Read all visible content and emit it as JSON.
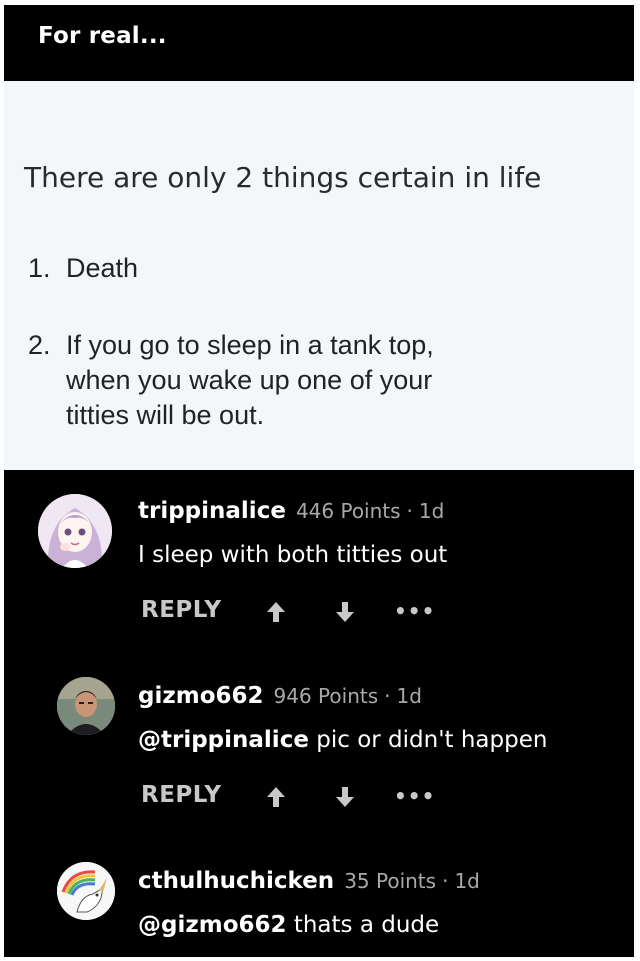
{
  "header": {
    "title": "For real..."
  },
  "post": {
    "heading": "There are only 2 things certain in life",
    "items": [
      {
        "num": "1.",
        "lines": [
          "Death"
        ]
      },
      {
        "num": "2.",
        "lines": [
          "If you go to sleep in a tank top,",
          "when you wake up one of your",
          "titties will be out."
        ]
      }
    ]
  },
  "comments": [
    {
      "username": "trippinalice",
      "points": "446 Points",
      "separator": "·",
      "age": "1d",
      "mention": "",
      "text": "I sleep with both titties out",
      "reply_label": "REPLY",
      "avatar": "avatar-anime-girl"
    },
    {
      "username": "gizmo662",
      "points": "946 Points",
      "separator": "·",
      "age": "1d",
      "mention": "@trippinalice",
      "text": " pic or didn't happen",
      "reply_label": "REPLY",
      "avatar": "avatar-man-photo"
    },
    {
      "username": "cthulhuchicken",
      "points": "35 Points",
      "separator": "·",
      "age": "1d",
      "mention": "@gizmo662",
      "text": " thats a dude",
      "reply_label": "",
      "avatar": "avatar-unicorn-rainbow"
    }
  ],
  "actions": {
    "more_label": "•••"
  },
  "colors": {
    "background": "#000000",
    "post_background": "#f4f7f9",
    "meta_gray": "#a9a9a9"
  }
}
